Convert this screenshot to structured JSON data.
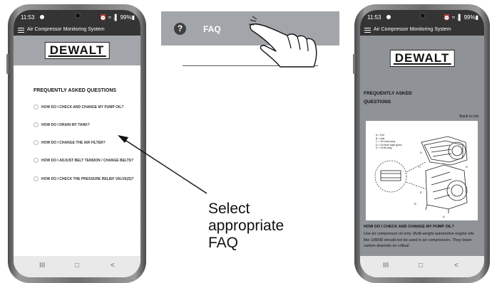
{
  "status_bar": {
    "time": "11:53",
    "right_left": "⏰ ≈ .▌ 99%▮",
    "right_right": "⏰ ≈ .▌ 99%▮"
  },
  "app": {
    "title": "Air Compressor Monitoring System",
    "brand": "DEWALT"
  },
  "left_screen": {
    "heading": "FREQUENTLY ASKED QUESTIONS",
    "questions": [
      "HOW DO I CHECK AND CHANGE MY PUMP OIL?",
      "HOW DO I DRAIN MY TANK?",
      "HOW DO I CHANGE THE AIR FILTER?",
      "HOW DO I ADJUST BELT TENSION / CHANGE BELTS?",
      "HOW DO I CHECK THE PRESSURE RELIEF VALVE(S)?"
    ]
  },
  "callout": {
    "icon_glyph": "?",
    "label": "FAQ"
  },
  "instruction": {
    "line1": "Select",
    "line2": "appropriate",
    "line3": "FAQ"
  },
  "right_screen": {
    "heading_line1": "FREQUENTLY ASKED",
    "heading_line2": "QUESTIONS",
    "back_link": "Back to list",
    "legend": [
      "A = Full",
      "B = Add",
      "C = Oil drain plug",
      "D = Oil level sight glass",
      "E = Oil fill plug"
    ],
    "question": "HOW DO I CHECK AND CHANGE MY PUMP OIL?",
    "answer": "Use air compressor oil only. Multi-weight automotive engine oils like 10W30 should not be used in air compressors. They leave carbon deposits on critical"
  },
  "nav": {
    "recent": "III",
    "home": "□",
    "back": "<"
  },
  "icons": {
    "help": "question-circle-icon",
    "hand": "pointing-hand-icon",
    "menu": "hamburger-icon"
  },
  "colors": {
    "status_bar": "#343434",
    "banner_gray": "#a2a6aa",
    "content_gray": "#8f9397"
  }
}
